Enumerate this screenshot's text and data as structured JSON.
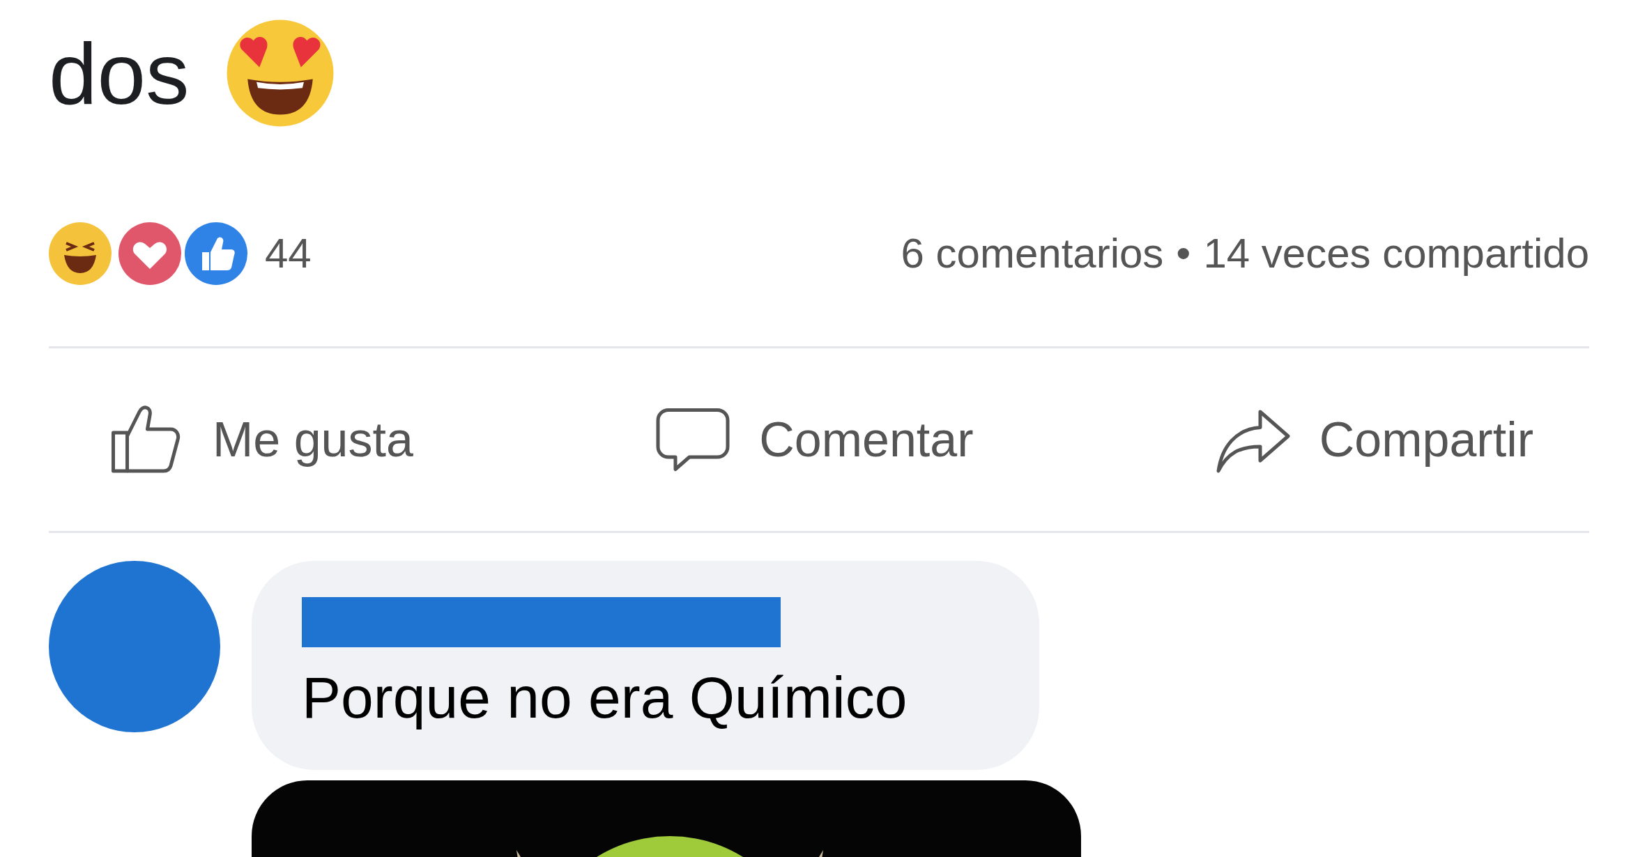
{
  "post": {
    "text": "dos"
  },
  "reactions": {
    "count": "44",
    "comments": "6 comentarios",
    "separator": "•",
    "shares": "14 veces compartido"
  },
  "actions": [
    {
      "label": "Me gusta",
      "kind": "like"
    },
    {
      "label": "Comentar",
      "kind": "comment"
    },
    {
      "label": "Compartir",
      "kind": "share"
    }
  ],
  "comment": {
    "text": "Porque no era Químico"
  }
}
